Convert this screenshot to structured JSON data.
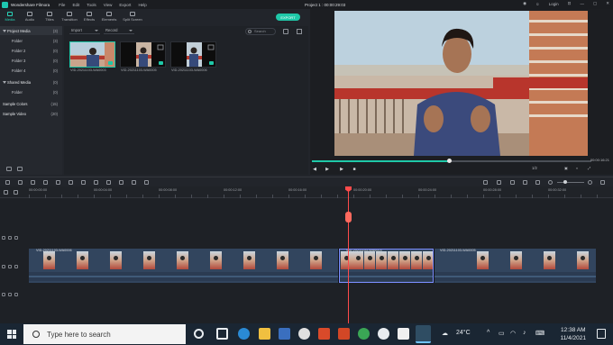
{
  "titlebar": {
    "app_name": "Wondershare Filmora",
    "menu": [
      "File",
      "Edit",
      "Tools",
      "View",
      "Export",
      "Help"
    ],
    "project_title": "Project 1 : 00:00:29:03",
    "login": "Login"
  },
  "toolbar": {
    "tabs": [
      {
        "label": "Media",
        "icon": "media-icon"
      },
      {
        "label": "Audio",
        "icon": "audio-icon"
      },
      {
        "label": "Titles",
        "icon": "titles-icon"
      },
      {
        "label": "Transition",
        "icon": "transition-icon"
      },
      {
        "label": "Effects",
        "icon": "effects-icon"
      },
      {
        "label": "Elements",
        "icon": "elements-icon"
      },
      {
        "label": "Split Screen",
        "icon": "split-screen-icon"
      }
    ],
    "export": "EXPORT"
  },
  "tree": {
    "project_media": {
      "label": "Project Media",
      "count": "(3)"
    },
    "folders": [
      {
        "label": "Folder",
        "count": "(3)"
      },
      {
        "label": "Folder 2",
        "count": "(0)"
      },
      {
        "label": "Folder 3",
        "count": "(0)"
      },
      {
        "label": "Folder 4",
        "count": "(0)"
      }
    ],
    "shared_media": {
      "label": "Shared Media",
      "count": "(0)"
    },
    "shared_folder": {
      "label": "Folder",
      "count": "(0)"
    },
    "sample_colors": {
      "label": "Sample Colors",
      "count": "(15)"
    },
    "sample_video": {
      "label": "Sample Video",
      "count": "(20)"
    }
  },
  "media": {
    "import": "Import",
    "record": "Record",
    "search_placeholder": "Search",
    "items": [
      {
        "name": "VID-20211103-WA0003"
      },
      {
        "name": "VID-20211103-WA0005"
      },
      {
        "name": "VID-20211103-WA0006"
      }
    ]
  },
  "preview": {
    "timecode": "00:00:16:21",
    "ratio": "1/2",
    "progress": 0.49
  },
  "ruler": {
    "labels": [
      "00:00:00:00",
      "00:00:04:00",
      "00:00:08:00",
      "00:00:12:00",
      "00:00:16:00",
      "00:00:20:00",
      "00:00:24:00",
      "00:00:28:00",
      "00:00:32:00",
      "00:00:36:00",
      "00:00:40:00"
    ]
  },
  "timeline": {
    "clip_names": [
      "VID-20211103-WA0006",
      "VID-20211103-WA0003",
      "VID-20211103-WA0005"
    ]
  },
  "taskbar": {
    "search_placeholder": "Type here to search",
    "weather": "24°C",
    "time": "12:38 AM",
    "date": "11/4/2021"
  }
}
